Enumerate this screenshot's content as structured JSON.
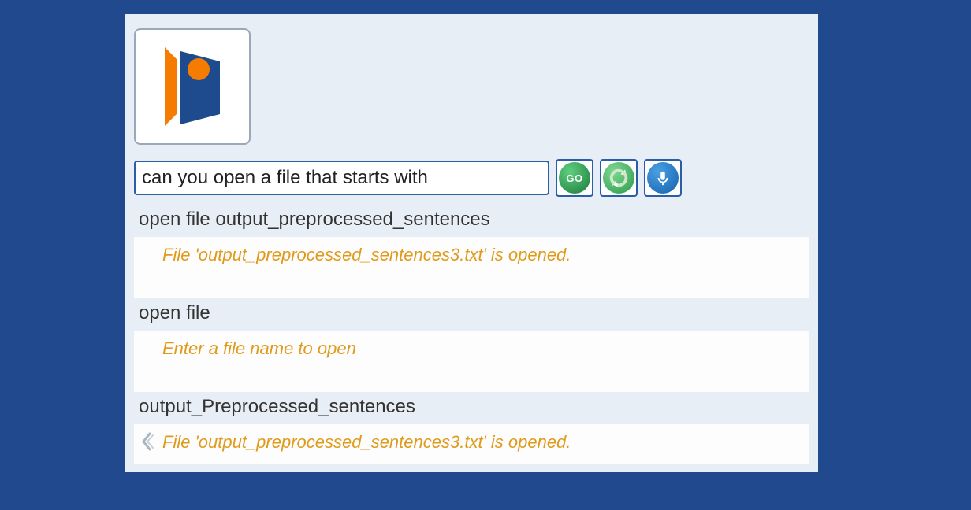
{
  "input": {
    "value": "can you open a file that starts with "
  },
  "buttons": {
    "go_label": "GO"
  },
  "history": [
    {
      "command": "open file output_preprocessed_sentences",
      "response": "File 'output_preprocessed_sentences3.txt' is opened."
    },
    {
      "command": "open file",
      "response": "Enter a file name to open"
    },
    {
      "command": "output_Preprocessed_sentences",
      "response": "File 'output_preprocessed_sentences3.txt' is opened."
    }
  ]
}
